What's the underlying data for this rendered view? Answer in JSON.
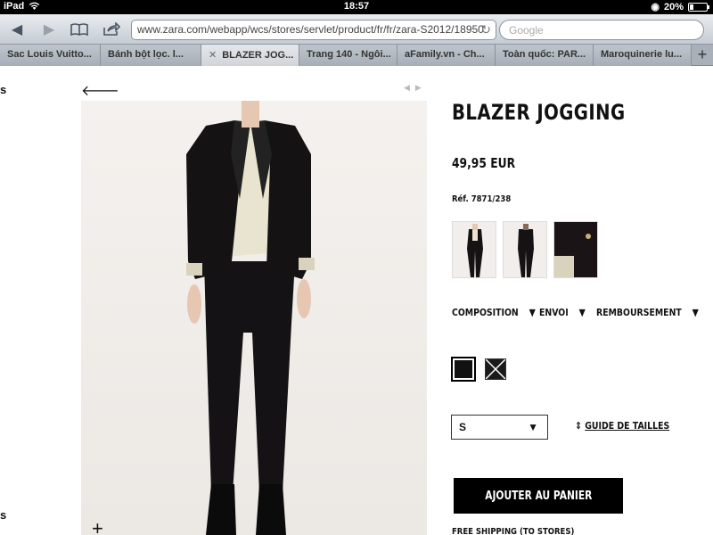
{
  "status": {
    "device": "iPad",
    "time": "18:57",
    "battery": "20%",
    "battery_level": 0.2
  },
  "browser": {
    "url": "www.zara.com/webapp/wcs/stores/servlet/product/fr/fr/zara-S2012/18950",
    "search_placeholder": "Google",
    "tabs": [
      {
        "label": "Sac Louis Vuitto..."
      },
      {
        "label": "Bánh bột lọc. l..."
      },
      {
        "label": "BLAZER JOG...",
        "active": true
      },
      {
        "label": "Trang 140 - Ngôi..."
      },
      {
        "label": "aFamily.vn - Ch..."
      },
      {
        "label": "Toàn quốc: PAR..."
      },
      {
        "label": "Maroquinerie lu..."
      }
    ],
    "new_tab": "+"
  },
  "page": {
    "side_letter": "s",
    "product": {
      "title": "BLAZER JOGGING",
      "price": "49,95 EUR",
      "reference": "Réf. 7871/238",
      "info_tabs": [
        "COMPOSITION",
        "ENVOI",
        "REMBOURSEMENT"
      ],
      "size_selected": "S",
      "size_guide": "GUIDE DE TAILLES",
      "add_to_cart": "AJOUTER AU PANIER",
      "free_shipping": "FREE SHIPPING (TO STORES)"
    },
    "colors": {
      "swatch_black": "#111111",
      "swatch_white": "#ffffff",
      "button_bg": "#000000"
    }
  }
}
